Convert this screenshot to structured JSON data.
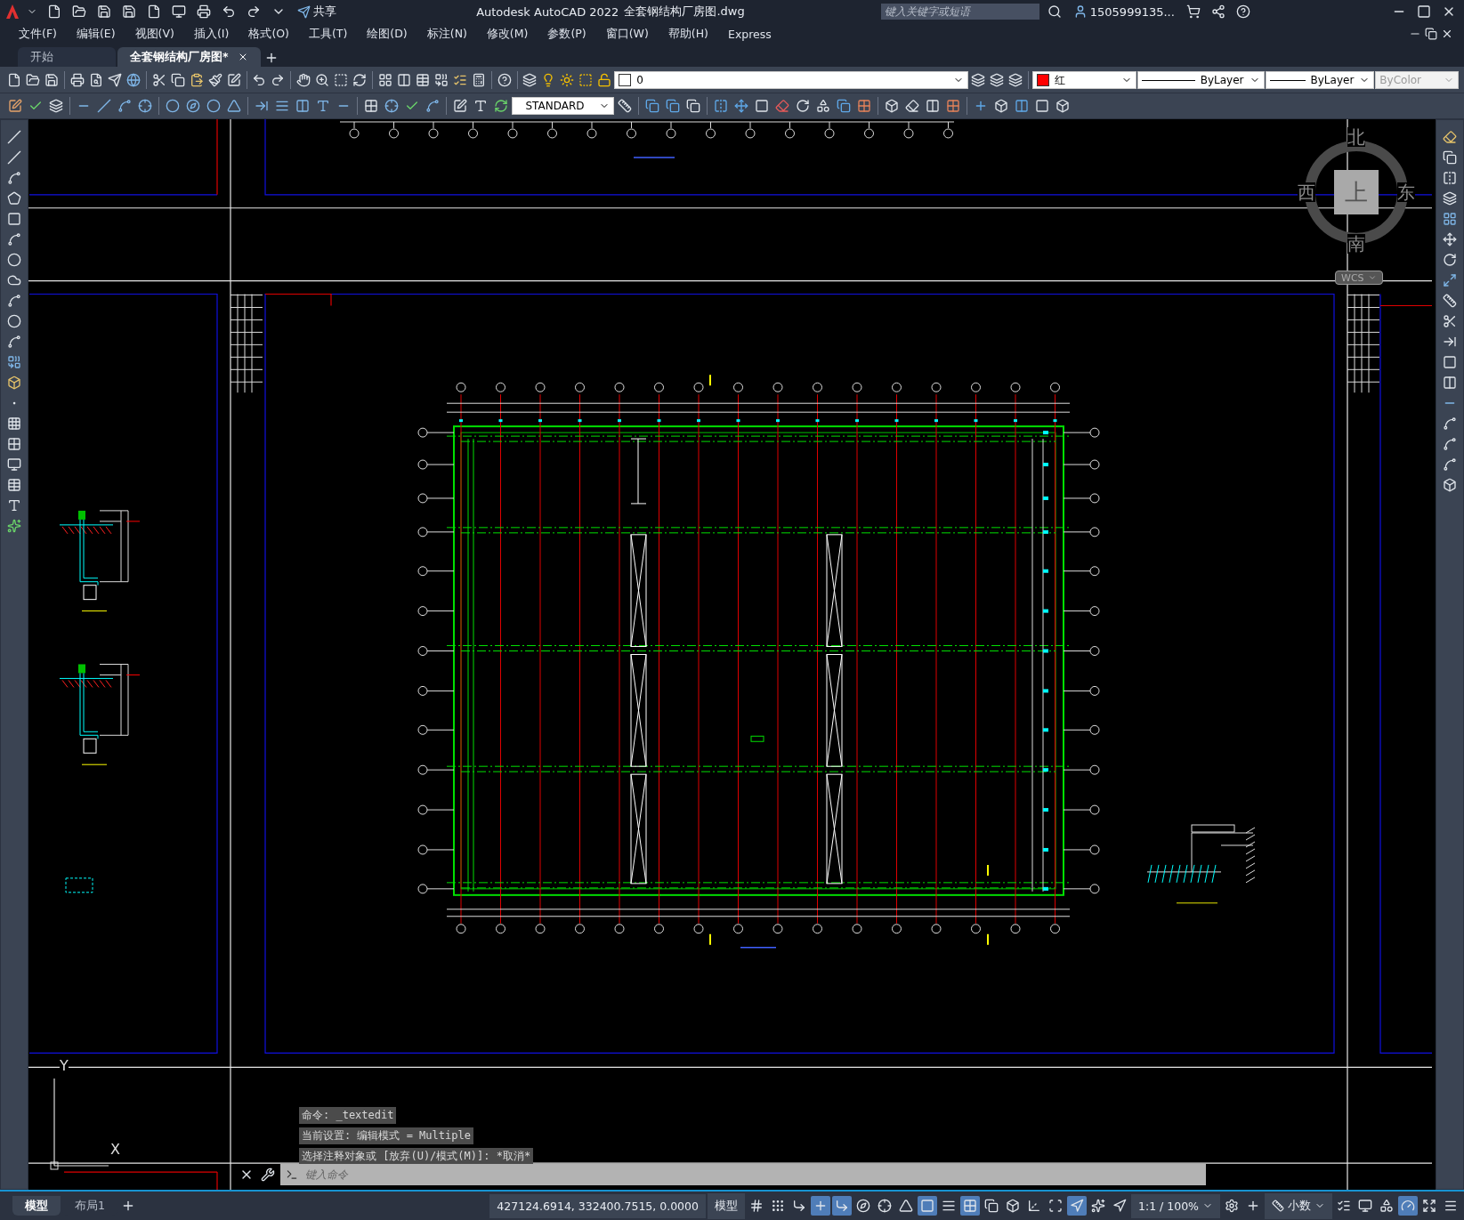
{
  "title_bar": {
    "share": "共享",
    "title": "Autodesk AutoCAD 2022",
    "file": "全套钢结构厂房图.dwg",
    "search": {
      "placeholder": "键入关键字或短语"
    },
    "user": "1505999135..."
  },
  "menu": [
    "文件(F)",
    "编辑(E)",
    "视图(V)",
    "插入(I)",
    "格式(O)",
    "工具(T)",
    "绘图(D)",
    "标注(N)",
    "修改(M)",
    "参数(P)",
    "窗口(W)",
    "帮助(H)",
    "Express"
  ],
  "doc_tabs": [
    {
      "label": "开始",
      "selected": false
    },
    {
      "label": "全套钢结构厂房图*",
      "selected": true
    }
  ],
  "properties": {
    "layer": "0",
    "color": {
      "label": "红",
      "color": "#ff0000"
    },
    "linetype": "ByLayer",
    "lineweight": "ByLayer",
    "plot_style": {
      "value": "ByColor",
      "disabled": true
    }
  },
  "text_style": "STANDARD",
  "viewcube": {
    "north": "北",
    "east": "东",
    "south": "南",
    "west": "西",
    "face": "上",
    "coordinate_system": "WCS"
  },
  "ucs": {
    "x": "X",
    "y": "Y"
  },
  "command_history": [
    "命令: _textedit",
    "当前设置: 编辑模式 = Multiple",
    "选择注释对象或 [放弃(U)/模式(M)]: *取消*"
  ],
  "command_input": {
    "placeholder": "键入命令"
  },
  "layout_tabs": [
    {
      "label": "模型",
      "selected": true
    },
    {
      "label": "布局1",
      "selected": false
    }
  ],
  "status_bar": {
    "coordinates": "427124.6914, 332400.7515, 0.0000",
    "space": "模型",
    "scale": "1:1 / 100%",
    "units": "小数"
  },
  "status_toggles": [
    {
      "on": false
    },
    {
      "on": false
    },
    {
      "on": false
    },
    {
      "on": true
    },
    {
      "on": true
    },
    {
      "on": false
    },
    {
      "on": false
    },
    {
      "on": false
    },
    {
      "on": true
    },
    {
      "on": false
    },
    {
      "on": true
    },
    {
      "on": false
    },
    {
      "on": false
    },
    {
      "on": false
    },
    {
      "on": false
    },
    {
      "on": true
    },
    {
      "on": false
    },
    {
      "on": false
    }
  ]
}
